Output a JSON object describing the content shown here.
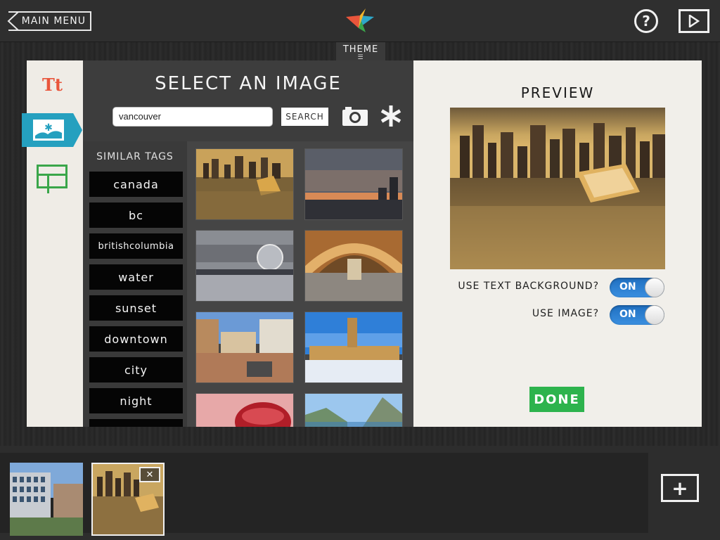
{
  "topbar": {
    "main_menu_label": "MAIN MENU",
    "help_label": "?",
    "theme_label": "THEME"
  },
  "editor": {
    "select_title": "SELECT AN IMAGE",
    "search_value": "vancouver",
    "search_button_label": "SEARCH",
    "similar_tags_title": "SIMILAR TAGS",
    "tags": [
      "canada",
      "bc",
      "britishcolumbia",
      "water",
      "sunset",
      "downtown",
      "city",
      "night"
    ]
  },
  "preview": {
    "title": "PREVIEW",
    "use_text_background_label": "USE TEXT BACKGROUND?",
    "use_text_background_value": "ON",
    "use_image_label": "USE IMAGE?",
    "use_image_value": "ON",
    "done_label": "DONE"
  },
  "slides": {
    "close_label": "✕",
    "add_label": "+"
  },
  "colors": {
    "accent_blue": "#25a0bf",
    "text_icon_red": "#e9553b",
    "layout_green": "#3aa64a",
    "done_green": "#2db34d",
    "toggle_blue": "#2f7fd0"
  },
  "icons": [
    "chevron-left-icon",
    "logo-icon",
    "help-icon",
    "play-icon",
    "text-icon",
    "image-icon",
    "layout-icon",
    "camera-icon",
    "asterisk-icon",
    "close-icon",
    "plus-icon"
  ]
}
